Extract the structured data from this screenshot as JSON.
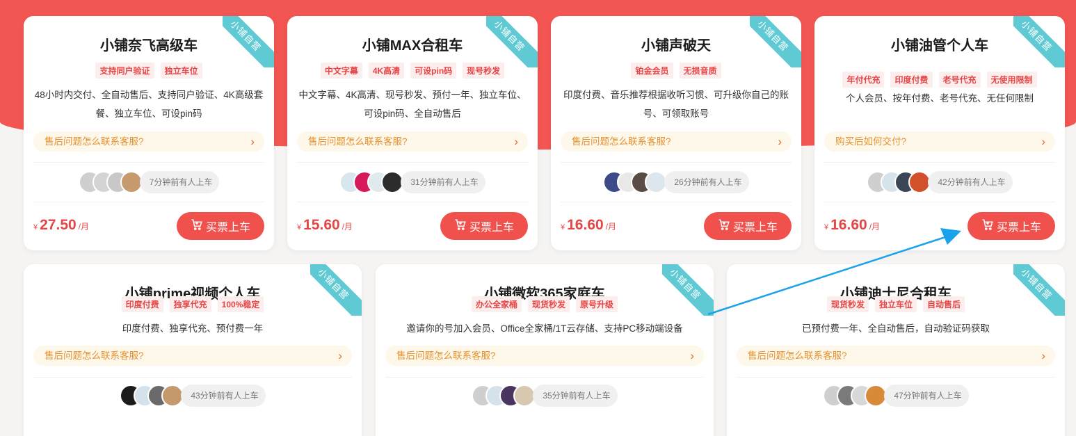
{
  "colors": {
    "accent": "#f1514d",
    "ribbon": "#5fcad3",
    "tag_bg": "#fdeeee",
    "faq_text": "#e8902c",
    "arrow": "#1aa3ea"
  },
  "cards": [
    {
      "ribbon": "小铺自营",
      "title": "小铺奈飞高级车",
      "tags": [
        "支持同户验证",
        "独立车位"
      ],
      "desc": "48小时内交付、全自动售后、支持同户验证、4K高级套餐、独立车位、可设pin码",
      "faq": "售后问题怎么联系客服?",
      "riders_text": "7分钟前有人上车",
      "avatar_colors": [
        "#cfcfcf",
        "#d4d4d4",
        "#c8c8c8",
        "#c79a6e"
      ],
      "currency": "¥",
      "price": "27.50",
      "unit": "/月",
      "buy_label": "买票上车"
    },
    {
      "ribbon": "小铺自营",
      "title": "小铺MAX合租车",
      "tags": [
        "中文字幕",
        "4K高清",
        "可设pin码",
        "现号秒发"
      ],
      "desc": "中文字幕、4K高清、现号秒发、预付一年、独立车位、可设pin码、全自动售后",
      "faq": "售后问题怎么联系客服?",
      "riders_text": "31分钟前有人上车",
      "avatar_colors": [
        "#d8e6ee",
        "#d6195a",
        "#dfe9ee",
        "#2c2c2c"
      ],
      "currency": "¥",
      "price": "15.60",
      "unit": "/月",
      "buy_label": "买票上车"
    },
    {
      "ribbon": "小铺自营",
      "title": "小铺声破天",
      "tags": [
        "铂金会员",
        "无损音质"
      ],
      "desc": "印度付费、音乐推荐根据收听习惯、可升级你自己的账号、可领取账号",
      "faq": "售后问题怎么联系客服?",
      "riders_text": "26分钟前有人上车",
      "avatar_colors": [
        "#3d4a8a",
        "#e8e8e8",
        "#5a4b45",
        "#dde6ec"
      ],
      "currency": "¥",
      "price": "16.60",
      "unit": "/月",
      "buy_label": "买票上车"
    },
    {
      "ribbon": "小铺自营",
      "title": "小铺油管个人车",
      "tags": [
        "年付代充",
        "印度付费",
        "老号代充",
        "无使用限制"
      ],
      "desc": "个人会员、按年付费、老号代充、无任何限制",
      "faq": "购买后如何交付?",
      "riders_text": "42分钟前有人上车",
      "avatar_colors": [
        "#cfcfcf",
        "#d6e3ea",
        "#3b4656",
        "#d2512a"
      ],
      "currency": "¥",
      "price": "16.60",
      "unit": "/月",
      "buy_label": "买票上车"
    },
    {
      "ribbon": "小铺自营",
      "title": "小铺prime视频个人车",
      "tags": [
        "印度付费",
        "独享代充",
        "100%稳定"
      ],
      "desc": "印度付费、独享代充、预付费一年",
      "faq": "售后问题怎么联系客服?",
      "riders_text": "43分钟前有人上车",
      "avatar_colors": [
        "#1c1c1c",
        "#d5e2ea",
        "#6a6a6a",
        "#c49a6c"
      ],
      "currency": "",
      "price": "",
      "unit": "",
      "buy_label": ""
    },
    {
      "ribbon": "小铺自营",
      "title": "小铺微软365家庭车",
      "tags": [
        "办公全家桶",
        "现货秒发",
        "原号升级"
      ],
      "desc": "邀请你的号加入会员、Office全家桶/1T云存储、支持PC移动端设备",
      "faq": "售后问题怎么联系客服?",
      "riders_text": "35分钟前有人上车",
      "avatar_colors": [
        "#cfcfcf",
        "#d5e2ea",
        "#4a3560",
        "#d9c8b0"
      ],
      "currency": "",
      "price": "",
      "unit": "",
      "buy_label": ""
    },
    {
      "ribbon": "小铺自营",
      "title": "小铺迪士尼合租车",
      "tags": [
        "现货秒发",
        "独立车位",
        "自动售后"
      ],
      "desc": "已预付费一年、全自动售后，自动验证码获取",
      "faq": "售后问题怎么联系客服?",
      "riders_text": "47分钟前有人上车",
      "avatar_colors": [
        "#cfcfcf",
        "#7a7a7a",
        "#d8d8d8",
        "#d88a3a"
      ],
      "currency": "",
      "price": "",
      "unit": "",
      "buy_label": ""
    }
  ]
}
